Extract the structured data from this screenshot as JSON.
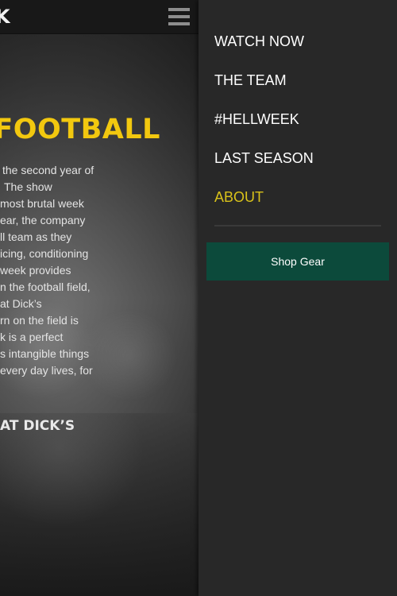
{
  "page": {
    "topbar": {
      "logo_glyph": "K"
    },
    "headline": "FOOTBALL",
    "body_lines": [
      "the second year of",
      "The show",
      "most brutal week",
      "ear, the company",
      "ll team as they",
      "icing, conditioning",
      "week provides",
      "n the football field,",
      "at Dick’s",
      "rn on the field is",
      "k is a perfect",
      "s intangible things",
      "every day lives, for"
    ],
    "cta": "AT DICK’S"
  },
  "drawer": {
    "menu": [
      {
        "label": "WATCH NOW",
        "active": false
      },
      {
        "label": "THE TEAM",
        "active": false
      },
      {
        "label": "#HELLWEEK",
        "active": false
      },
      {
        "label": "LAST SEASON",
        "active": false
      },
      {
        "label": "ABOUT",
        "active": true
      }
    ],
    "shop_button": "Shop Gear"
  },
  "colors": {
    "accent_yellow": "#f2c80f",
    "active_menu": "#d9c21a",
    "shop_button_bg": "#0c4a3b",
    "drawer_bg": "#282828"
  },
  "icons": {
    "menu": "hamburger-menu-icon"
  }
}
